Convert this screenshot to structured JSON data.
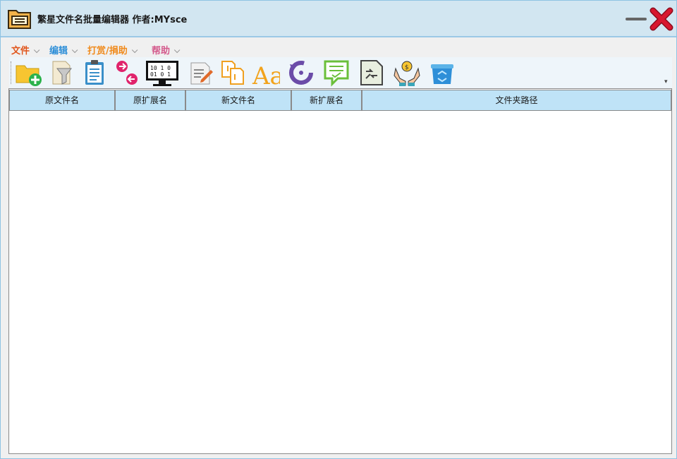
{
  "window": {
    "title": "繁星文件名批量编辑器  作者:MYsce"
  },
  "menu": {
    "items": [
      {
        "label": "文件",
        "color": "#e0541a"
      },
      {
        "label": "编辑",
        "color": "#2e8fd8"
      },
      {
        "label": "打赏/捐助",
        "color": "#f08a1c"
      },
      {
        "label": "帮助",
        "color": "#d45a8c"
      }
    ]
  },
  "toolbar": {
    "buttons": [
      {
        "icon": "add-folder-icon"
      },
      {
        "icon": "filter-file-icon"
      },
      {
        "icon": "clipboard-list-icon"
      },
      {
        "icon": "move-in-out-icon"
      },
      {
        "icon": "binary-monitor-icon"
      },
      {
        "icon": "edit-document-icon"
      },
      {
        "icon": "copy-files-icon"
      },
      {
        "icon": "font-case-icon"
      },
      {
        "icon": "undo-icon"
      },
      {
        "icon": "comment-check-icon"
      },
      {
        "icon": "replace-file-icon"
      },
      {
        "icon": "donate-hands-icon"
      },
      {
        "icon": "recycle-bin-icon"
      }
    ]
  },
  "table": {
    "columns": [
      "原文件名",
      "原扩展名",
      "新文件名",
      "新扩展名",
      "文件夹路径"
    ],
    "rows": []
  },
  "colors": {
    "titlebar_bg": "#d2e6f1",
    "header_bg": "#bfe3f7",
    "close_red": "#c8102e"
  }
}
